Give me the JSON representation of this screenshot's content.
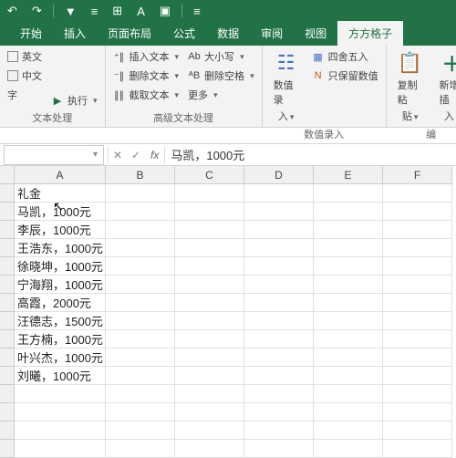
{
  "titlebar": {
    "icons": [
      "↶",
      "↷",
      "▼",
      "≡",
      "⊞",
      "A",
      "▣",
      "≡"
    ]
  },
  "tabs": {
    "items": [
      {
        "label": "开始"
      },
      {
        "label": "插入"
      },
      {
        "label": "页面布局"
      },
      {
        "label": "公式"
      },
      {
        "label": "数据"
      },
      {
        "label": "审阅"
      },
      {
        "label": "视图"
      },
      {
        "label": "方方格子",
        "active": true
      }
    ]
  },
  "ribbon": {
    "group1": {
      "label": "文本处理",
      "items": [
        {
          "check": true,
          "text": "英文"
        },
        {
          "check": true,
          "text": "中文"
        },
        {
          "text": "字"
        },
        {
          "icon": "▶",
          "text": "执行",
          "dd": true
        }
      ]
    },
    "group2": {
      "label": "高级文本处理",
      "col1": [
        {
          "icon": "⁺∥",
          "text": "插入文本",
          "dd": true
        },
        {
          "icon": "⁻∥",
          "text": "删除文本",
          "dd": true
        },
        {
          "icon": "∥∥",
          "text": "截取文本",
          "dd": true
        }
      ],
      "col2": [
        {
          "icon": "Ab",
          "text": "大小写",
          "dd": true
        },
        {
          "icon": "ᴬB",
          "text": "删除空格",
          "dd": true
        },
        {
          "text": "更多",
          "dd": true
        }
      ]
    },
    "group3": {
      "label": "数值录入",
      "big": {
        "icon": "☷",
        "text1": "数值录",
        "text2": "入",
        "dd": true
      },
      "col": [
        {
          "icon": "▦",
          "text": "四舍五入"
        },
        {
          "icon": "N",
          "text": "只保留数值"
        }
      ]
    },
    "group4": {
      "label": "编",
      "big1": {
        "icon": "📋",
        "text1": "复制粘",
        "text2": "贴",
        "dd": true
      },
      "big2": {
        "icon": "＋",
        "text1": "新增插",
        "text2": "入",
        "dd": true
      }
    }
  },
  "formula": {
    "name_box": "",
    "dd": "▾",
    "cancel": "✕",
    "confirm": "✓",
    "fx": "fx",
    "value": "马凯，1000元"
  },
  "columns": [
    "A",
    "B",
    "C",
    "D",
    "E",
    "F"
  ],
  "cells": [
    "礼金",
    "马凯，1000元",
    "李辰，1000元",
    "王浩东，1000元",
    "徐晓坤，1000元",
    "宁海翔，1000元",
    "高霞，2000元",
    "汪德志，1500元",
    "王方楠，1000元",
    "叶兴杰，1000元",
    "刘曦，1000元"
  ]
}
